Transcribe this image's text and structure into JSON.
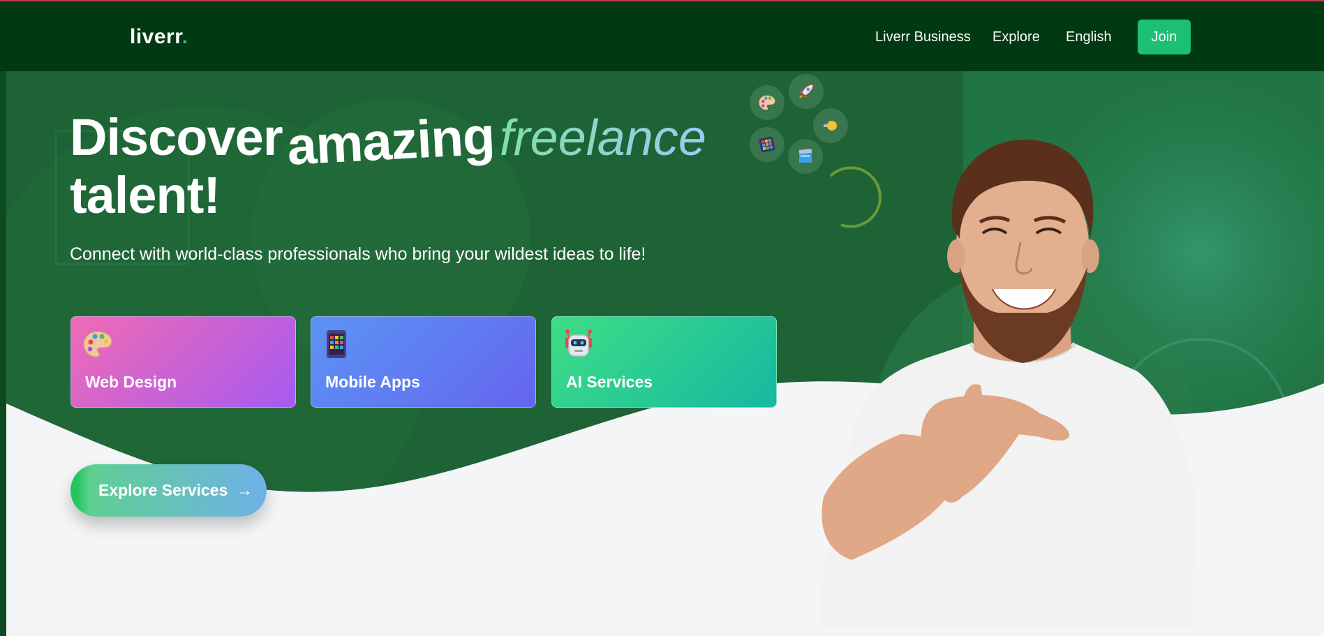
{
  "brand": {
    "name": "liverr",
    "dot": ".",
    "accent": "#1dbf73"
  },
  "nav": {
    "links": [
      "Liverr Business",
      "Explore",
      "English"
    ],
    "join_label": "Join"
  },
  "hero": {
    "headline": {
      "word1": "Discover",
      "word2": "amazing",
      "word3": "freelance",
      "line2": "talent!"
    },
    "subtitle": "Connect with world-class professionals who bring your wildest ideas to life!",
    "cards": [
      {
        "label": "Web Design",
        "icon": "palette-icon"
      },
      {
        "label": "Mobile Apps",
        "icon": "mobile-phone-icon"
      },
      {
        "label": "AI Services",
        "icon": "robot-icon"
      }
    ],
    "cta": {
      "label": "Explore Services",
      "arrow": "→"
    },
    "floating_icons": [
      "palette-icon",
      "rocket-icon",
      "lightbulb-icon",
      "calculator-icon",
      "laptop-icon"
    ]
  },
  "colors": {
    "nav_bg": "#013a12",
    "hero_bg": "#1d6335",
    "page_bg": "#f4f5f7"
  }
}
